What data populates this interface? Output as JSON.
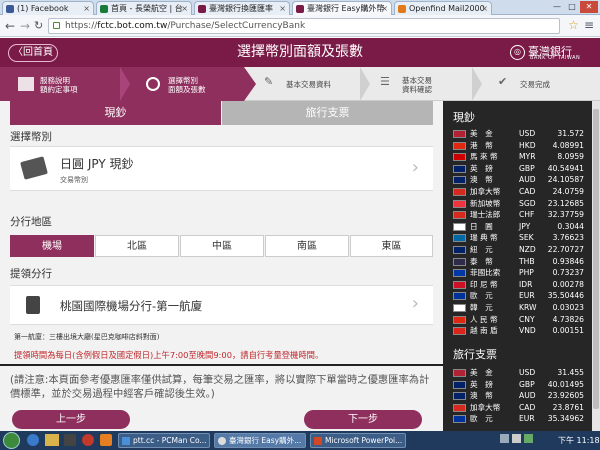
{
  "browser": {
    "tabs": [
      {
        "label": "(1) Facebook",
        "color": "#3b5998"
      },
      {
        "label": "首頁 - 長榮航空 | 台",
        "color": "#1a7a3a"
      },
      {
        "label": "臺灣銀行換匯匯率",
        "color": "#7a1a47"
      },
      {
        "label": "臺灣銀行 Easy購外幣",
        "color": "#7a1a47"
      },
      {
        "label": "Openfind Mail2000",
        "color": "#e07a1a"
      }
    ],
    "url_prefix": "https://",
    "url_host": "fctc.bot.com.tw",
    "url_path": "/Purchase/SelectCurrencyBank",
    "min": "—",
    "max": "□",
    "close": "✕"
  },
  "header": {
    "home_label": "〈回首頁",
    "title": "選擇幣別面額及張數",
    "bank_zh": "臺灣銀行",
    "bank_en": "BANK OF TAIWAN"
  },
  "steps": [
    {
      "label1": "服務說明",
      "label2": "額約定事項"
    },
    {
      "label1": "選擇幣別",
      "label2": "面額及張數"
    },
    {
      "label1": "基本交易資料",
      "label2": ""
    },
    {
      "label1": "基本交易",
      "label2": "資料確認"
    },
    {
      "label1": "交易完成",
      "label2": ""
    }
  ],
  "main": {
    "tab_cash": "現鈔",
    "tab_travel": "旅行支票",
    "currency_section": "選擇幣別",
    "currency_name": "日圓 JPY 現鈔",
    "currency_sub": "交易幣別",
    "region_section": "分行地區",
    "regions": [
      "機場",
      "北區",
      "中區",
      "南區",
      "東區"
    ],
    "branch_section": "提領分行",
    "branch_name": "桃園國際機場分行-第一航廈",
    "branch_note": "第一航廈：三樓出境大廳(星巴克咖啡店斜對面)",
    "hours_note": "提領時間為每日(含例假日及國定假日)上午7:00至晚間9:00，請自行考量登機時間。",
    "notice": "(請注意:本頁面參考優惠匯率僅供試算，每筆交易之匯率，將以實際下單當時之優惠匯率為計價標準，並於交易過程中經客戶確認後生效。)",
    "prev": "上一步",
    "next": "下一步"
  },
  "rates": {
    "cash_title": "現鈔",
    "cash": [
      {
        "name": "美　金",
        "code": "USD",
        "value": "31.572",
        "flag": "#b22234"
      },
      {
        "name": "港　幣",
        "code": "HKD",
        "value": "4.08991",
        "flag": "#de2910"
      },
      {
        "name": "馬 來 幣",
        "code": "MYR",
        "value": "8.0959",
        "flag": "#cc0001"
      },
      {
        "name": "英　鎊",
        "code": "GBP",
        "value": "40.54941",
        "flag": "#012169"
      },
      {
        "name": "澳　幣",
        "code": "AUD",
        "value": "24.10587",
        "flag": "#012169"
      },
      {
        "name": "加拿大幣",
        "code": "CAD",
        "value": "24.0759",
        "flag": "#d52b1e"
      },
      {
        "name": "新加坡幣",
        "code": "SGD",
        "value": "23.12685",
        "flag": "#ef3340"
      },
      {
        "name": "瑞士法郎",
        "code": "CHF",
        "value": "32.37759",
        "flag": "#d52b1e"
      },
      {
        "name": "日　圓",
        "code": "JPY",
        "value": "0.3044",
        "flag": "#ffffff"
      },
      {
        "name": "瑞 典 幣",
        "code": "SEK",
        "value": "3.76623",
        "flag": "#006aa7"
      },
      {
        "name": "紐　元",
        "code": "NZD",
        "value": "22.70727",
        "flag": "#012169"
      },
      {
        "name": "泰　幣",
        "code": "THB",
        "value": "0.93846",
        "flag": "#2d2a4a"
      },
      {
        "name": "菲國比索",
        "code": "PHP",
        "value": "0.73237",
        "flag": "#0038a8"
      },
      {
        "name": "印 尼 幣",
        "code": "IDR",
        "value": "0.00278",
        "flag": "#ce1126"
      },
      {
        "name": "歐　元",
        "code": "EUR",
        "value": "35.50446",
        "flag": "#003399"
      },
      {
        "name": "韓　元",
        "code": "KRW",
        "value": "0.03023",
        "flag": "#ffffff"
      },
      {
        "name": "人 民 幣",
        "code": "CNY",
        "value": "4.73826",
        "flag": "#de2910"
      },
      {
        "name": "越 南 盾",
        "code": "VND",
        "value": "0.00151",
        "flag": "#da251d"
      }
    ],
    "travel_title": "旅行支票",
    "travel": [
      {
        "name": "美　金",
        "code": "USD",
        "value": "31.455",
        "flag": "#b22234"
      },
      {
        "name": "英　鎊",
        "code": "GBP",
        "value": "40.01495",
        "flag": "#012169"
      },
      {
        "name": "澳　幣",
        "code": "AUD",
        "value": "23.92605",
        "flag": "#012169"
      },
      {
        "name": "加拿大幣",
        "code": "CAD",
        "value": "23.8761",
        "flag": "#d52b1e"
      },
      {
        "name": "歐　元",
        "code": "EUR",
        "value": "35.34962",
        "flag": "#003399"
      }
    ]
  },
  "taskbar": {
    "items": [
      "ptt.cc - PCMan Co...",
      "臺灣銀行 Easy購外...",
      "Microsoft PowerPoi..."
    ],
    "clock": "下午 11:18"
  },
  "colors": {
    "brand": "#7a1a47",
    "accent": "#8f2f5d",
    "panel": "#262626"
  }
}
